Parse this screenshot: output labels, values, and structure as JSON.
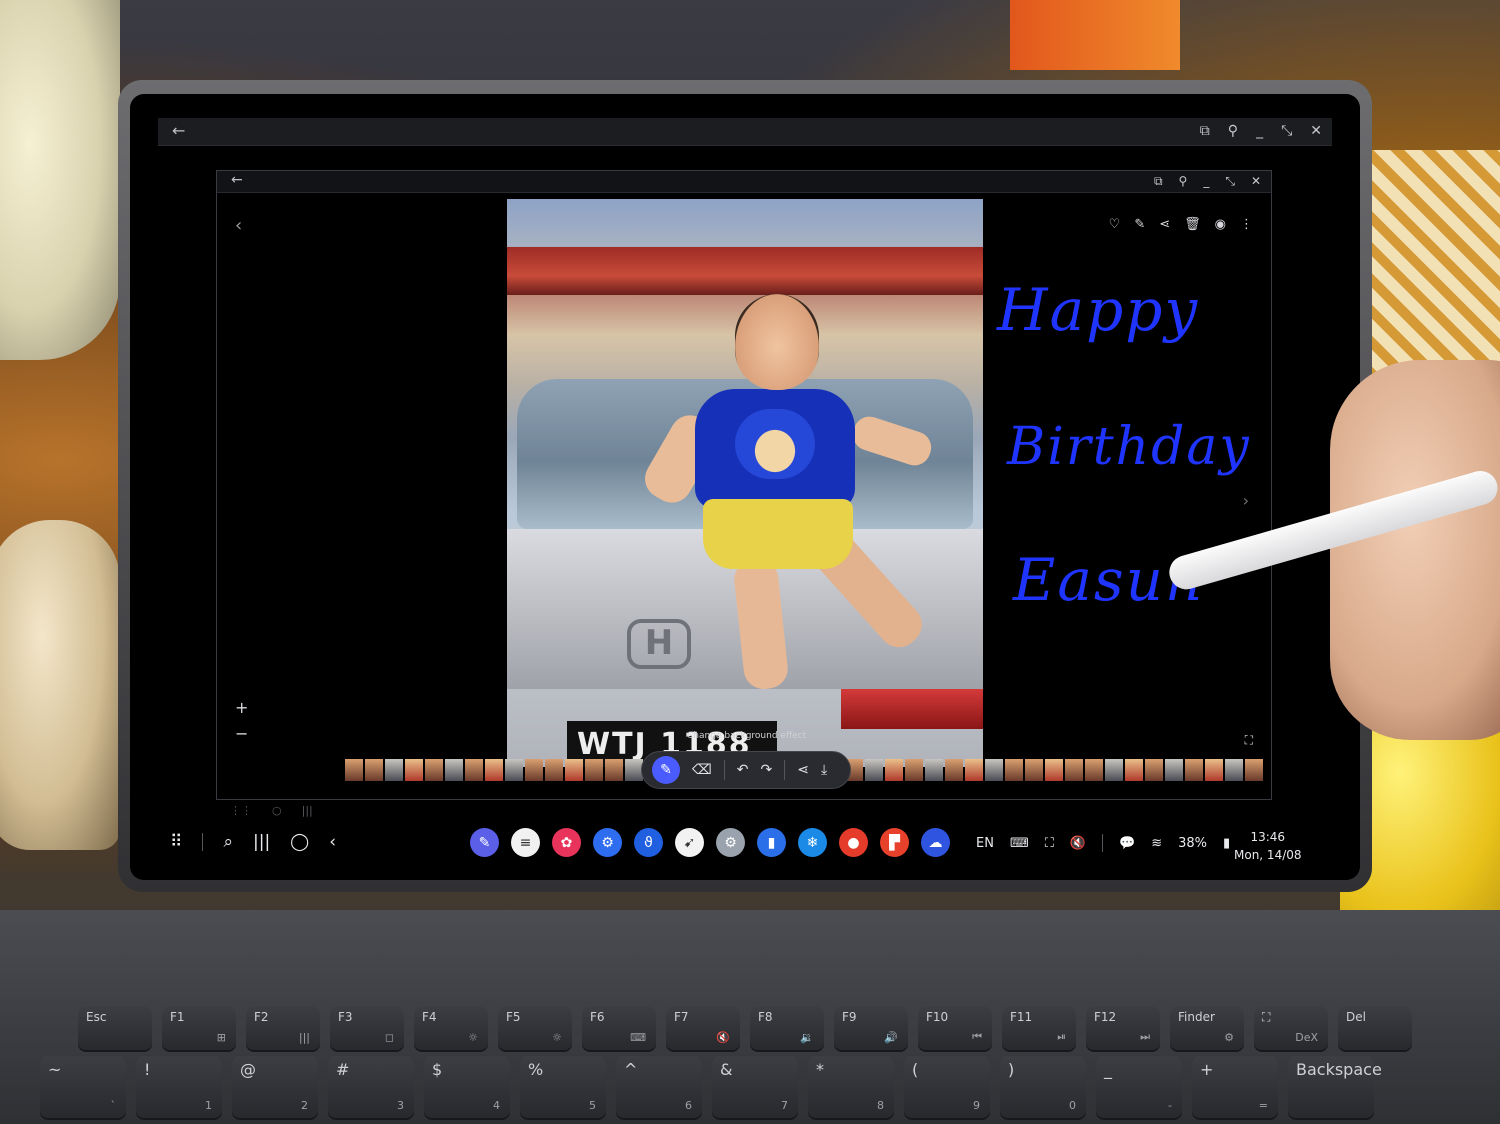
{
  "photo": {
    "plate_text": "WTJ 1188",
    "emblem": "H"
  },
  "handwriting": {
    "line1": "Happy",
    "line2": "Birthday",
    "line3": "Easun",
    "color": "#1f34ff"
  },
  "viewer": {
    "bg_effect_label": "Change background effect",
    "zoom_in": "+",
    "zoom_out": "−"
  },
  "taskbar": {
    "language": "EN",
    "battery": "38%",
    "time": "13:46",
    "date": "Mon, 14/08",
    "apps": [
      {
        "icon": "pen-app-icon",
        "color": "#5b5fe8",
        "glyph": "✎"
      },
      {
        "icon": "notes-icon",
        "color": "#f1f1f1",
        "glyph": "≡"
      },
      {
        "icon": "flower-icon",
        "color": "#e8345a",
        "glyph": "✿"
      },
      {
        "icon": "settings-icon",
        "color": "#2f6df0",
        "glyph": "⚙"
      },
      {
        "icon": "hook-icon",
        "color": "#1f5fe0",
        "glyph": "ϑ"
      },
      {
        "icon": "swift-icon",
        "color": "#f2f2f2",
        "glyph": "➹"
      },
      {
        "icon": "gear-icon",
        "color": "#9aa2ad",
        "glyph": "⚙"
      },
      {
        "icon": "chart-icon",
        "color": "#2a6fe8",
        "glyph": "▮"
      },
      {
        "icon": "snowflake-icon",
        "color": "#1a8ae6",
        "glyph": "❄"
      },
      {
        "icon": "record-icon",
        "color": "#e53b2b",
        "glyph": "●"
      },
      {
        "icon": "flipboard-icon",
        "color": "#e8412b",
        "glyph": "▛"
      },
      {
        "icon": "cloud-icon",
        "color": "#2f55e0",
        "glyph": "☁"
      }
    ]
  },
  "keyboard": {
    "fn_row": [
      {
        "label": "Esc",
        "sub": ""
      },
      {
        "label": "F1",
        "sub": "⊞"
      },
      {
        "label": "F2",
        "sub": "|||"
      },
      {
        "label": "F3",
        "sub": "◻"
      },
      {
        "label": "F4",
        "sub": "☼"
      },
      {
        "label": "F5",
        "sub": "☼"
      },
      {
        "label": "F6",
        "sub": "⌨"
      },
      {
        "label": "F7",
        "sub": "🔇"
      },
      {
        "label": "F8",
        "sub": "🔉"
      },
      {
        "label": "F9",
        "sub": "🔊"
      },
      {
        "label": "F10",
        "sub": "⏮"
      },
      {
        "label": "F11",
        "sub": "⏯"
      },
      {
        "label": "F12",
        "sub": "⏭"
      },
      {
        "label": "Finder",
        "sub": "⚙"
      },
      {
        "label": "⛶",
        "sub": "DeX"
      },
      {
        "label": "Del",
        "sub": ""
      }
    ],
    "num_row": [
      {
        "label": "~",
        "sub": "`"
      },
      {
        "label": "!",
        "sub": "1"
      },
      {
        "label": "@",
        "sub": "2"
      },
      {
        "label": "#",
        "sub": "3"
      },
      {
        "label": "$",
        "sub": "4"
      },
      {
        "label": "%",
        "sub": "5"
      },
      {
        "label": "^",
        "sub": "6"
      },
      {
        "label": "&",
        "sub": "7"
      },
      {
        "label": "*",
        "sub": "8"
      },
      {
        "label": "(",
        "sub": "9"
      },
      {
        "label": ")",
        "sub": "0"
      },
      {
        "label": "_",
        "sub": "-"
      },
      {
        "label": "+",
        "sub": "="
      },
      {
        "label": "Backspace",
        "sub": ""
      }
    ]
  }
}
